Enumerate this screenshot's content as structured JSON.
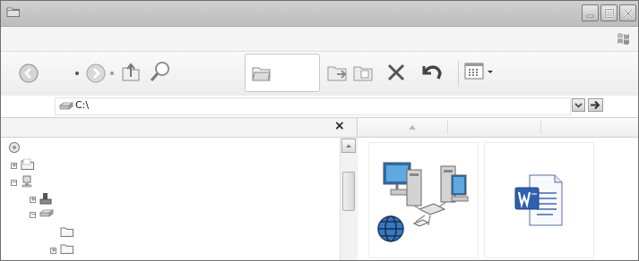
{
  "address_bar": {
    "path": "C:\\"
  },
  "folders_pane": {
    "close_glyph": "×"
  },
  "icons": {
    "title": "folder-icon",
    "back": "back-arrow-icon",
    "forward": "forward-arrow-icon",
    "up": "up-folder-icon",
    "search": "search-icon",
    "folders": "folders-icon",
    "move_to": "move-to-icon",
    "copy_to": "copy-to-icon",
    "delete": "delete-icon",
    "undo": "undo-icon",
    "views": "views-icon"
  },
  "content": {
    "items": [
      {
        "icon": "network-icon"
      },
      {
        "icon": "word-document-icon"
      }
    ]
  }
}
